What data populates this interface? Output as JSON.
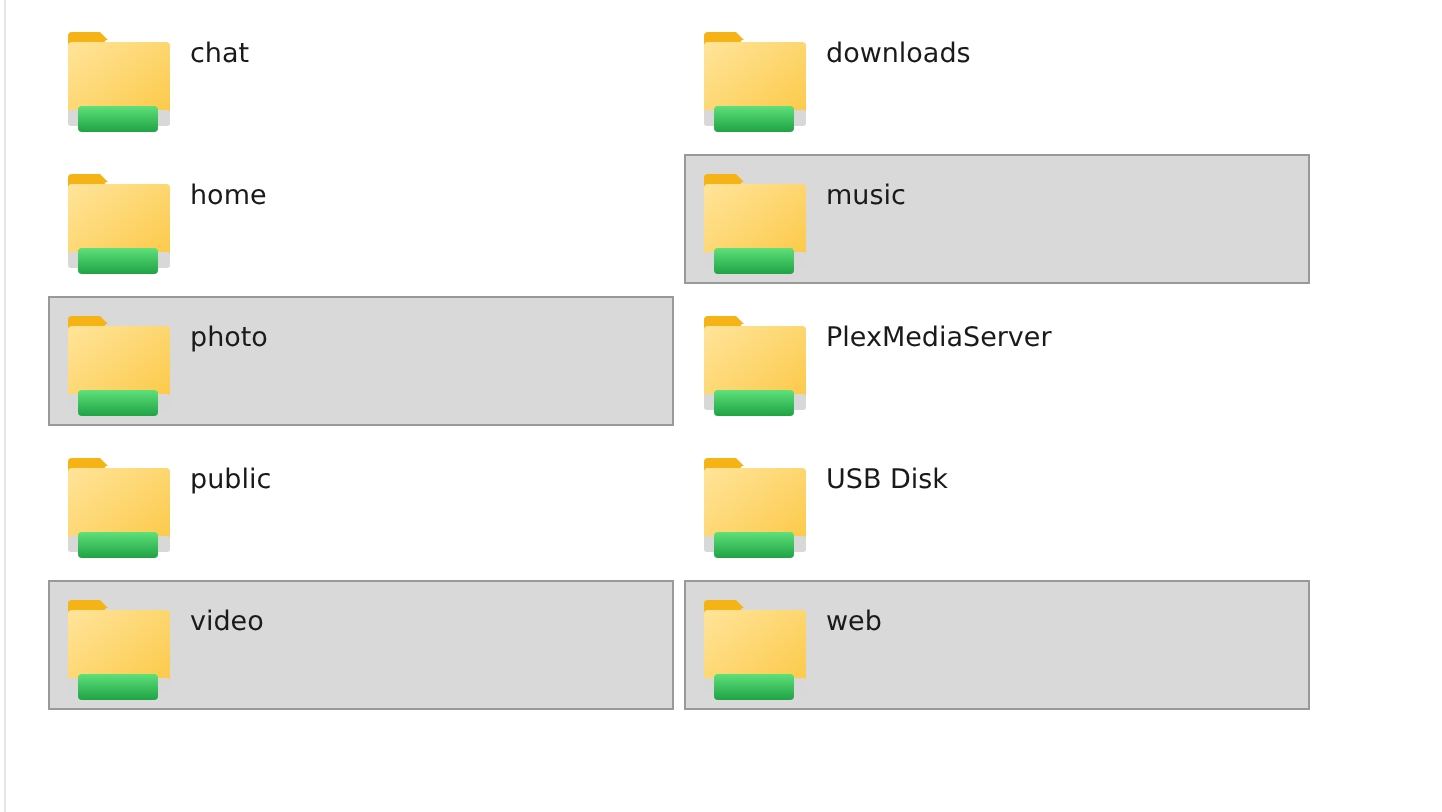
{
  "folders": [
    {
      "name": "chat",
      "selected": false
    },
    {
      "name": "downloads",
      "selected": false
    },
    {
      "name": "home",
      "selected": false
    },
    {
      "name": "music",
      "selected": true
    },
    {
      "name": "photo",
      "selected": true
    },
    {
      "name": "PlexMediaServer",
      "selected": false
    },
    {
      "name": "public",
      "selected": false
    },
    {
      "name": "USB Disk",
      "selected": false
    },
    {
      "name": "video",
      "selected": true
    },
    {
      "name": "web",
      "selected": true
    }
  ]
}
